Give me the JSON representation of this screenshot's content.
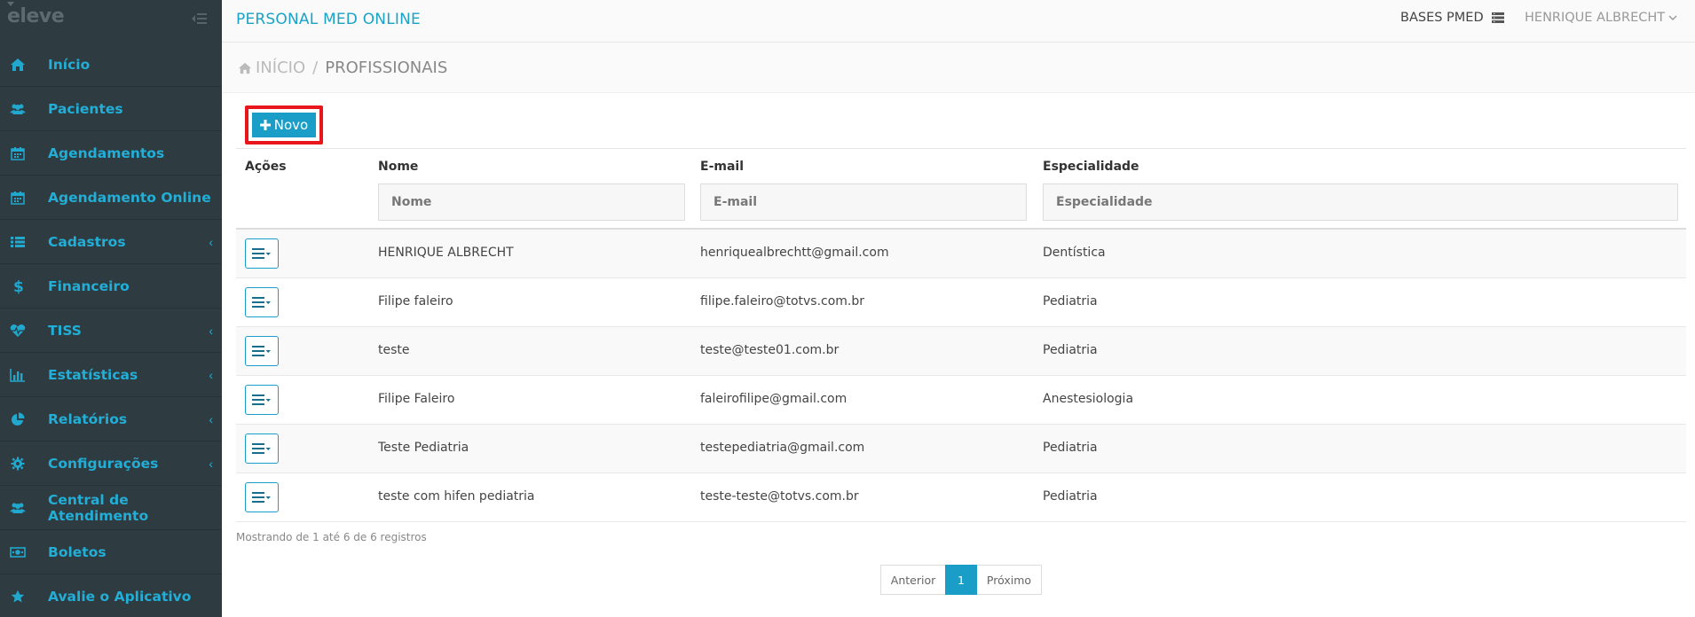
{
  "sidebar": {
    "logo": "eleve",
    "items": [
      {
        "label": "Início",
        "icon": "home-icon",
        "has_chevron": false
      },
      {
        "label": "Pacientes",
        "icon": "users-icon",
        "has_chevron": false
      },
      {
        "label": "Agendamentos",
        "icon": "calendar-icon",
        "has_chevron": false
      },
      {
        "label": "Agendamento Online",
        "icon": "calendar-icon",
        "has_chevron": false
      },
      {
        "label": "Cadastros",
        "icon": "list-icon",
        "has_chevron": true
      },
      {
        "label": "Financeiro",
        "icon": "dollar-icon",
        "has_chevron": false
      },
      {
        "label": "TISS",
        "icon": "heartbeat-icon",
        "has_chevron": true
      },
      {
        "label": "Estatísticas",
        "icon": "bar-chart-icon",
        "has_chevron": true
      },
      {
        "label": "Relatórios",
        "icon": "pie-chart-icon",
        "has_chevron": true
      },
      {
        "label": "Configurações",
        "icon": "gear-icon",
        "has_chevron": true
      },
      {
        "label": "Central de Atendimento",
        "icon": "users-icon",
        "has_chevron": false
      },
      {
        "label": "Boletos",
        "icon": "money-icon",
        "has_chevron": false
      },
      {
        "label": "Avalie o Aplicativo",
        "icon": "star-icon",
        "has_chevron": false
      }
    ],
    "chevron": "‹"
  },
  "header": {
    "title": "PERSONAL MED ONLINE",
    "bases_label": "BASES PMED",
    "user_name": "HENRIQUE ALBRECHT"
  },
  "breadcrumb": {
    "home": "INÍCIO",
    "separator": "/",
    "current": "PROFISSIONAIS"
  },
  "toolbar": {
    "new_label": "Novo"
  },
  "table": {
    "columns": [
      "Ações",
      "Nome",
      "E-mail",
      "Especialidade"
    ],
    "filters": {
      "nome_placeholder": "Nome",
      "email_placeholder": "E-mail",
      "especialidade_placeholder": "Especialidade"
    },
    "rows": [
      {
        "nome": "HENRIQUE ALBRECHT",
        "email": "henriquealbrechtt@gmail.com",
        "especialidade": "Dentística"
      },
      {
        "nome": "Filipe faleiro",
        "email": "filipe.faleiro@totvs.com.br",
        "especialidade": "Pediatria"
      },
      {
        "nome": "teste",
        "email": "teste@teste01.com.br",
        "especialidade": "Pediatria"
      },
      {
        "nome": "Filipe Faleiro",
        "email": "faleirofilipe@gmail.com",
        "especialidade": "Anestesiologia"
      },
      {
        "nome": "Teste Pediatria",
        "email": "testepediatria@gmail.com",
        "especialidade": "Pediatria"
      },
      {
        "nome": "teste com hifen pediatria",
        "email": "teste-teste@totvs.com.br",
        "especialidade": "Pediatria"
      }
    ]
  },
  "records_info": "Mostrando de 1 até 6 de 6 registros",
  "pagination": {
    "prev": "Anterior",
    "current": "1",
    "next": "Próximo"
  },
  "colors": {
    "sidebar_bg": "#2e3b40",
    "accent": "#1a9dc7",
    "highlight_border": "#e8161a"
  }
}
